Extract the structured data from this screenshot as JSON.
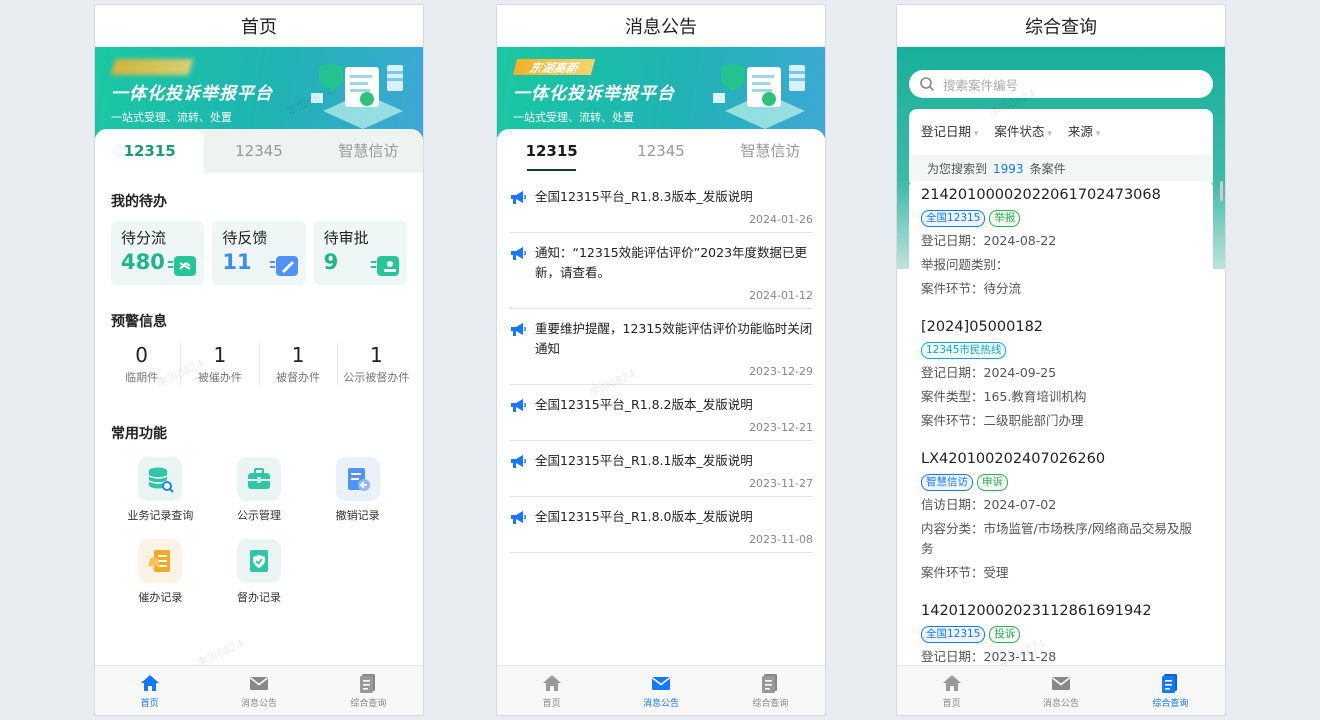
{
  "colors": {
    "accent": "#1677ff",
    "brand_green": "#1a9b7a",
    "banner_start": "#19c8a1",
    "banner_end": "#3ea8d6"
  },
  "watermark": "李恒0824",
  "nav": [
    {
      "label": "首页",
      "icon": "home-icon"
    },
    {
      "label": "消息公告",
      "icon": "mail-icon"
    },
    {
      "label": "综合查询",
      "icon": "document-icon"
    }
  ],
  "home": {
    "title": "首页",
    "banner": {
      "title": "一体化投诉举报平台",
      "subtitle": "一站式受理、流转、处置"
    },
    "tabs": [
      "12315",
      "12345",
      "智慧信访"
    ],
    "todo_title": "我的待办",
    "todos": [
      {
        "label": "待分流",
        "value": "480",
        "color": "#1fb48a",
        "icon": "share-icon"
      },
      {
        "label": "待反馈",
        "value": "11",
        "color": "#3d8bf0",
        "icon": "pen-icon"
      },
      {
        "label": "待审批",
        "value": "9",
        "color": "#1fb48a",
        "icon": "approve-icon"
      }
    ],
    "warn_title": "预警信息",
    "warnings": [
      {
        "value": "0",
        "label": "临期件"
      },
      {
        "value": "1",
        "label": "被催办件"
      },
      {
        "value": "1",
        "label": "被督办件"
      },
      {
        "value": "1",
        "label": "公示被督办件"
      }
    ],
    "func_title": "常用功能",
    "functions": [
      {
        "label": "业务记录查询",
        "icon": "database-search-icon"
      },
      {
        "label": "公示管理",
        "icon": "briefcase-icon"
      },
      {
        "label": "撤销记录",
        "icon": "revoke-doc-icon"
      },
      {
        "label": "催办记录",
        "icon": "bell-doc-icon"
      },
      {
        "label": "督办记录",
        "icon": "shield-doc-icon"
      }
    ]
  },
  "notices": {
    "title": "消息公告",
    "banner": {
      "tag": "东湖高新",
      "title": "一体化投诉举报平台",
      "subtitle": "一站式受理、流转、处置"
    },
    "tabs": [
      "12315",
      "12345",
      "智慧信访"
    ],
    "items": [
      {
        "text": "全国12315平台_R1.8.3版本_发版说明",
        "date": "2024-01-26"
      },
      {
        "text": "通知：“12315效能评估评价”2023年度数据已更新，请查看。",
        "date": "2024-01-12"
      },
      {
        "text": "重要维护提醒，12315效能评估评价功能临时关闭通知",
        "date": "2023-12-29"
      },
      {
        "text": "全国12315平台_R1.8.2版本_发版说明",
        "date": "2023-12-21"
      },
      {
        "text": "全国12315平台_R1.8.1版本_发版说明",
        "date": "2023-11-27"
      },
      {
        "text": "全国12315平台_R1.8.0版本_发版说明",
        "date": "2023-11-08"
      }
    ]
  },
  "query": {
    "title": "综合查询",
    "search_placeholder": "搜索案件编号",
    "filters": [
      "登记日期",
      "案件状态",
      "来源"
    ],
    "found_prefix": "为您搜索到",
    "found_count": "1993",
    "found_suffix": "条案件",
    "cases": [
      {
        "id": "214201000020220617024730​68",
        "tags": [
          {
            "t": "全国12315",
            "c": "blue"
          },
          {
            "t": "举报",
            "c": "green"
          }
        ],
        "lines": [
          "登记日期：2024-08-22",
          "举报问题类别：",
          "案件环节：待分流"
        ]
      },
      {
        "id": "[2024]05000182",
        "tags": [
          {
            "t": "12345市民热线",
            "c": "cyan"
          }
        ],
        "lines": [
          "登记日期：2024-09-25",
          "案件类型：165.教育培训机构",
          "案件环节：二级职能部门办理"
        ]
      },
      {
        "id": "LX420100202407026260",
        "tags": [
          {
            "t": "智慧信访",
            "c": "blue"
          },
          {
            "t": "申诉",
            "c": "green"
          }
        ],
        "lines": [
          "信访日期：2024-07-02",
          "内容分类：市场监管/市场秩序/网络商品交易及服务",
          "案件环节：受理"
        ]
      },
      {
        "id": "14201200020231128616919​42",
        "tags": [
          {
            "t": "全国12315",
            "c": "blue"
          },
          {
            "t": "投诉",
            "c": "green"
          }
        ],
        "lines": [
          "登记日期：2023-11-28"
        ]
      }
    ]
  }
}
